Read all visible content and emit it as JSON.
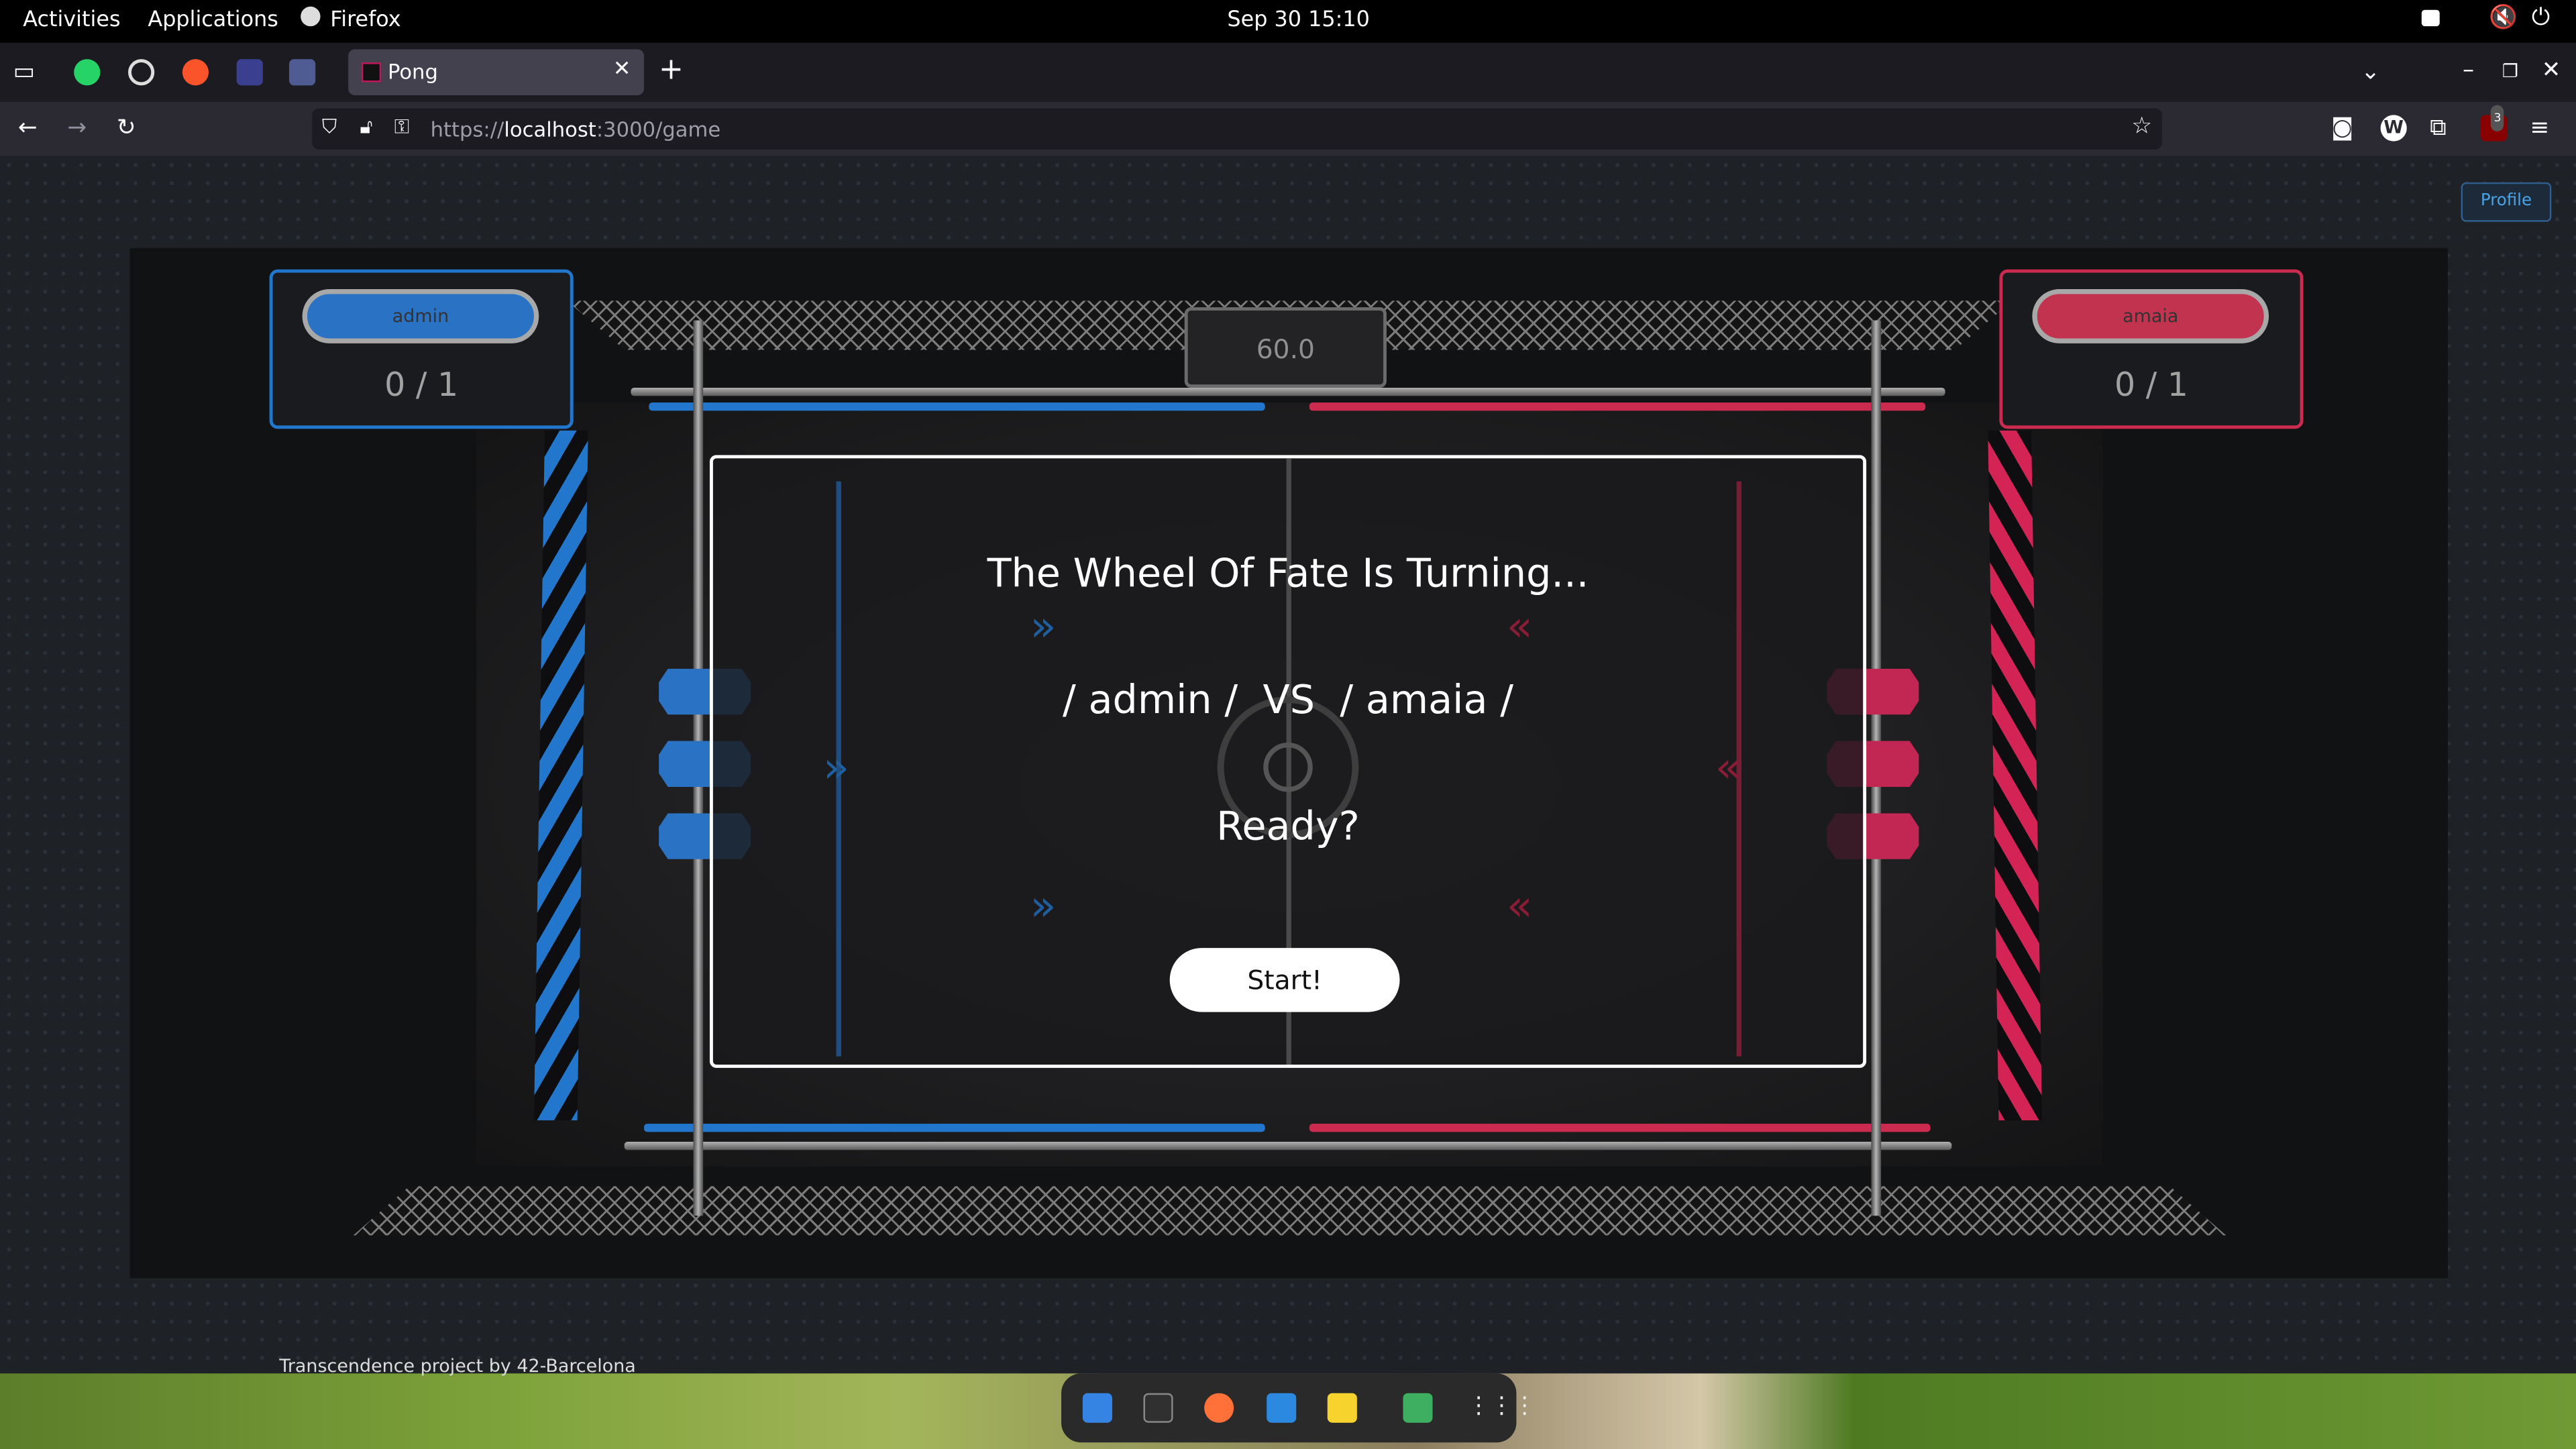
{
  "system_bar": {
    "activities": "Activities",
    "applications": "Applications",
    "app_name": "Firefox",
    "datetime": "Sep 30  15:10"
  },
  "browser": {
    "tab_title": "Pong",
    "url_prefix": "https://",
    "url_host": "localhost",
    "url_path": ":3000/game",
    "extension_badge": "3"
  },
  "page": {
    "profile_button": "Profile",
    "footer": "Transcendence project by 42-Barcelona"
  },
  "game": {
    "timer": "60.0",
    "player_left": {
      "name": "admin",
      "score": "0 / 1",
      "color": "#2277cc"
    },
    "player_right": {
      "name": "amaia",
      "score": "0 / 1",
      "color": "#cc2b50"
    },
    "modal": {
      "title": "The Wheel Of Fate Is Turning...",
      "matchup": "/ admin /  VS  / amaia /",
      "prompt": "Ready?",
      "start_label": "Start!"
    }
  },
  "icons": {
    "pinned_tabs": [
      "whatsapp-icon",
      "globe-icon",
      "brave-icon",
      "bracket-icon",
      "php-icon"
    ],
    "dock": [
      "files-icon",
      "terminal-icon",
      "firefox-icon",
      "vscode-icon",
      "notes-icon",
      "software-icon",
      "app-grid-icon"
    ]
  }
}
